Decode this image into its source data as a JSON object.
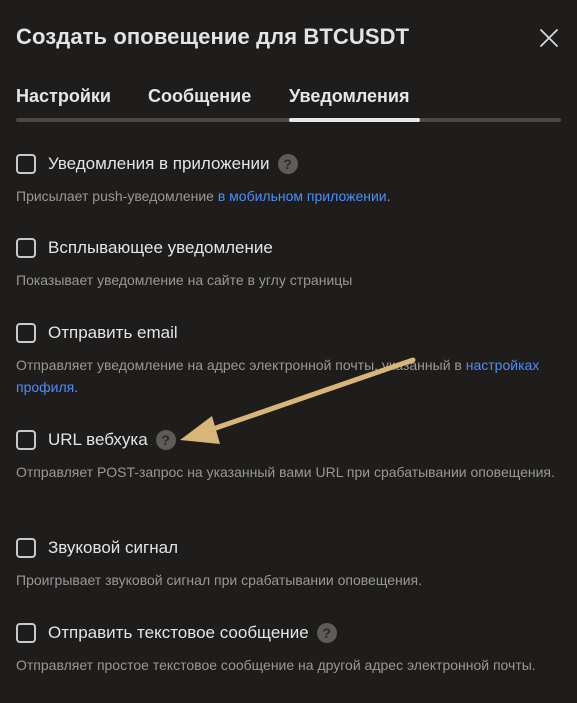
{
  "dialog": {
    "title": "Создать оповещение для BTCUSDT",
    "close_icon": "close-icon"
  },
  "tabs": [
    {
      "label": "Настройки",
      "active": false
    },
    {
      "label": "Сообщение",
      "active": false
    },
    {
      "label": "Уведомления",
      "active": true
    }
  ],
  "options": [
    {
      "label": "Уведомления в приложении",
      "checked": false,
      "has_help": true,
      "desc_before": "Присылает push-уведомление ",
      "desc_link": "в мобильном приложении",
      "desc_after": "."
    },
    {
      "label": "Всплывающее уведомление",
      "checked": false,
      "has_help": false,
      "desc_before": "Показывает уведомление на сайте в углу страницы",
      "desc_link": "",
      "desc_after": ""
    },
    {
      "label": "Отправить email",
      "checked": false,
      "has_help": false,
      "desc_before": "Отправляет уведомление на адрес электронной почты, указанный в ",
      "desc_link": "настройках профиля",
      "desc_after": "."
    },
    {
      "label": "URL вебхука",
      "checked": false,
      "has_help": true,
      "desc_before": "Отправляет POST-запрос на указанный вами URL при срабатывании оповещения.",
      "desc_link": "",
      "desc_after": ""
    },
    {
      "label": "Звуковой сигнал",
      "checked": false,
      "has_help": false,
      "desc_before": "Проигрывает звуковой сигнал при срабатывании оповещения.",
      "desc_link": "",
      "desc_after": ""
    },
    {
      "label": "Отправить текстовое сообщение",
      "checked": false,
      "has_help": true,
      "desc_before": "Отправляет простое текстовое сообщение на другой адрес электронной почты.",
      "desc_link": "",
      "desc_after": ""
    }
  ],
  "help_glyph": "?",
  "colors": {
    "background": "#1e1d1c",
    "link": "#4d8ef7",
    "arrow": "#d9b57a"
  }
}
